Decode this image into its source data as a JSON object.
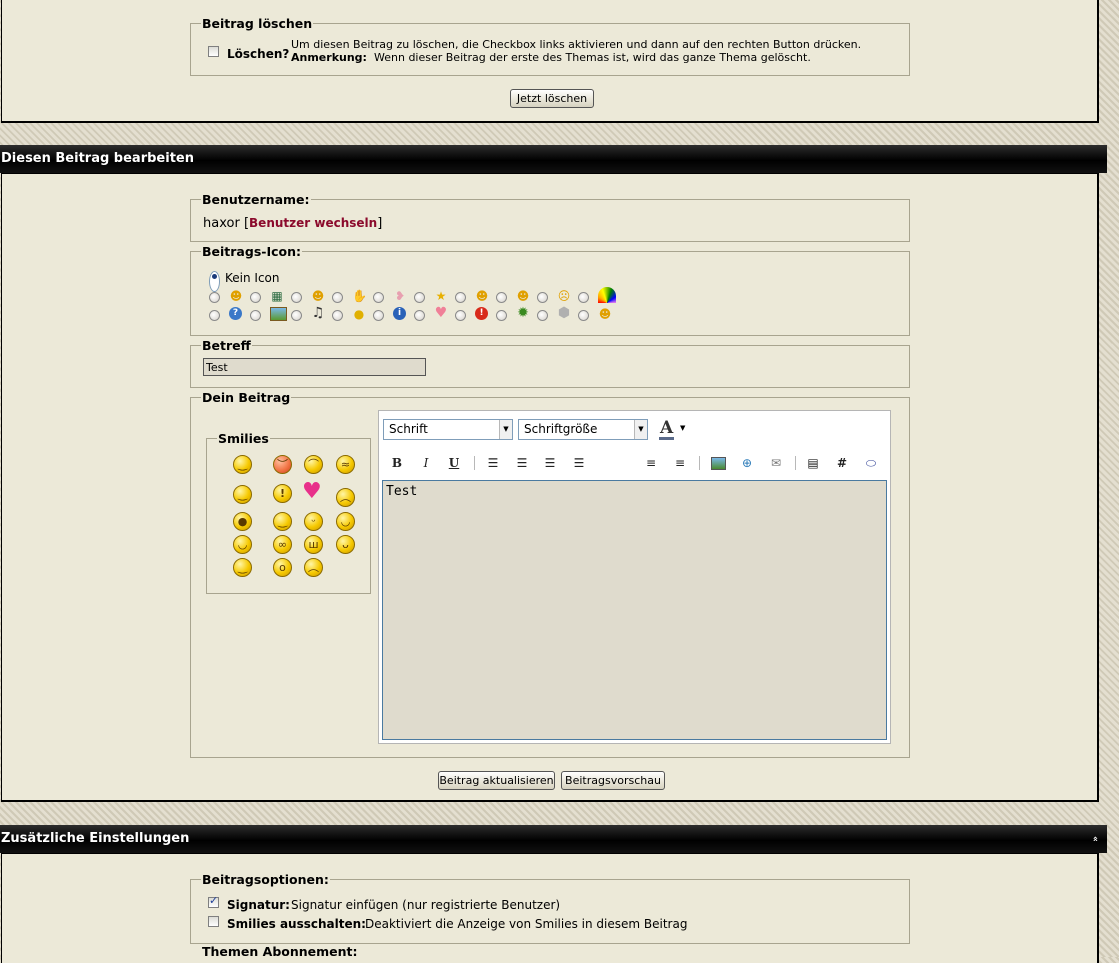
{
  "delete_section": {
    "legend": "Beitrag löschen",
    "checkbox_label": "Löschen?",
    "instruction": "Um diesen Beitrag zu löschen, die Checkbox links aktivieren und dann auf den rechten Button drücken.",
    "note_label": "Anmerkung:",
    "note_text": "Wenn dieser Beitrag der erste des Themas ist, wird das ganze Thema gelöscht.",
    "button_label": "Jetzt löschen"
  },
  "edit_header": {
    "title": "Diesen Beitrag bearbeiten"
  },
  "username": {
    "legend": "Benutzername:",
    "value": "haxor",
    "switch_link": "Benutzer wechseln",
    "bracket_open": "[",
    "bracket_close": "]"
  },
  "post_icon": {
    "legend": "Beitrags-Icon:",
    "no_icon_label": "Kein Icon",
    "row1_icons": [
      "smile-icon",
      "film-icon",
      "wink-icon",
      "hand-icon",
      "heart-ribbon-icon",
      "star-icon",
      "grin-icon",
      "surprised-icon",
      "sad-icon",
      "rainbow-icon"
    ],
    "row2_icons": [
      "question-icon",
      "picture-icon",
      "music-icon",
      "lightbulb-icon",
      "info-icon",
      "heart-icon",
      "exclamation-icon",
      "bug-icon",
      "box-icon",
      "laugh-icon"
    ]
  },
  "subject": {
    "legend": "Betreff",
    "value": "Test"
  },
  "post": {
    "legend": "Dein Beitrag",
    "smilies_legend": "Smilies",
    "font_select": "Schrift",
    "size_select": "Schriftgröße",
    "font_color_label": "A",
    "bold": "B",
    "italic": "I",
    "underline": "U",
    "hash": "#",
    "content": "Test"
  },
  "buttons": {
    "update": "Beitrag aktualisieren",
    "preview": "Beitragsvorschau"
  },
  "additional_header": {
    "title": "Zusätzliche Einstellungen",
    "collapse_glyph": "»"
  },
  "options": {
    "legend": "Beitragsoptionen:",
    "signature_label": "Signatur:",
    "signature_text": "Signatur einfügen (nur registrierte Benutzer)",
    "smilies_off_label": "Smilies ausschalten:",
    "smilies_off_text": "Deaktiviert die Anzeige von Smilies in diesem Beitrag"
  },
  "subscription": {
    "legend": "Themen Abonnement:"
  },
  "colors": {
    "header_bg": "#000000",
    "panel_bg": "#ece9d8",
    "link": "#8b0a2c",
    "editor_bg": "#dfdbcd"
  }
}
